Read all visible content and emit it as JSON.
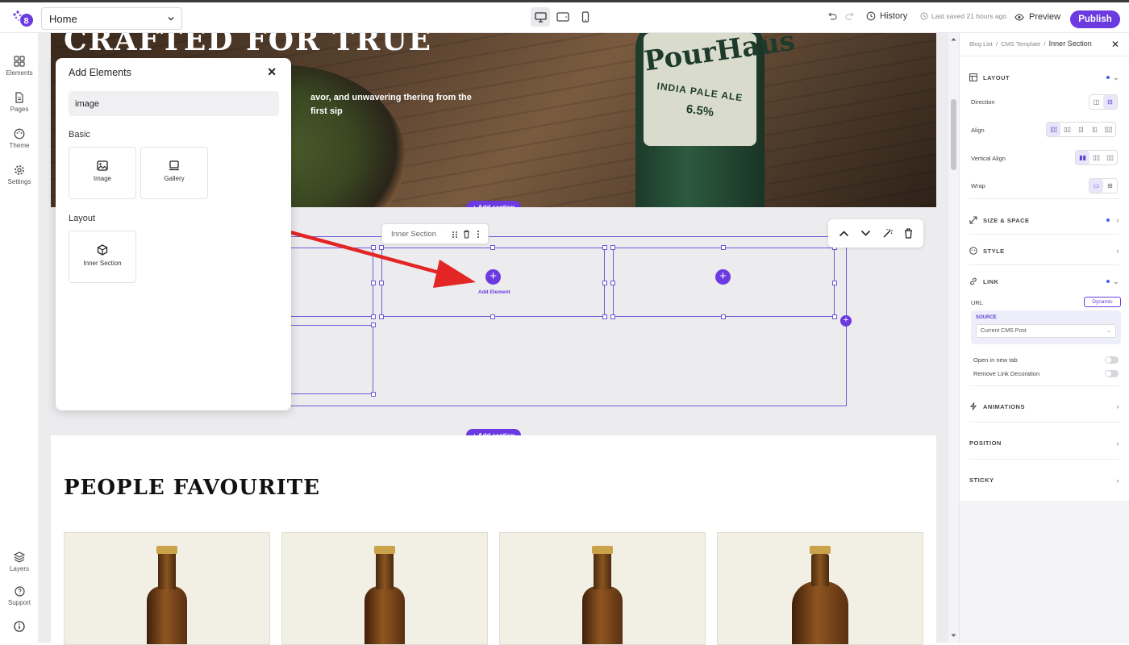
{
  "topbar": {
    "page_select": "Home",
    "history": "History",
    "last_saved": "Last saved 21 hours ago",
    "preview": "Preview",
    "publish": "Publish",
    "accent_color": "#6b3ae0"
  },
  "leftbar": {
    "items": [
      {
        "label": "Elements",
        "icon": "grid-icon"
      },
      {
        "label": "Pages",
        "icon": "page-icon"
      },
      {
        "label": "Theme",
        "icon": "palette-icon"
      },
      {
        "label": "Settings",
        "icon": "gear-icon"
      }
    ],
    "bottom": [
      {
        "label": "Layers",
        "icon": "layers-icon"
      },
      {
        "label": "Support",
        "icon": "help-icon"
      }
    ]
  },
  "canvas": {
    "hero_title": "CRAFTED FOR TRUE",
    "hero_text": "avor, and unwavering thering from the first sip",
    "bottle_brand": "PourHaus",
    "bottle_ipa": "INDIA PALE ALE",
    "bottle_abv": "6.5%",
    "add_section": "+ Add section",
    "add_element": "Add Element",
    "selected_tag": "Inner Section",
    "products_title": "PEOPLE FAVOURITE"
  },
  "modal": {
    "title": "Add Elements",
    "search_value": "image",
    "basic_label": "Basic",
    "layout_label": "Layout",
    "basic_tiles": [
      {
        "label": "Image",
        "icon": "image-icon"
      },
      {
        "label": "Gallery",
        "icon": "gallery-icon"
      }
    ],
    "layout_tiles": [
      {
        "label": "Inner Section",
        "icon": "cube-icon"
      }
    ]
  },
  "panel": {
    "breadcrumb": [
      "Blog List",
      "CMS Template",
      "Inner Section"
    ],
    "sections": {
      "layout": "LAYOUT",
      "size_space": "SIZE & SPACE",
      "style": "STYLE",
      "link": "LINK",
      "animations": "ANIMATIONS",
      "position": "POSITION",
      "sticky": "STICKY"
    },
    "props": {
      "direction": "Direction",
      "align": "Align",
      "vertical_align": "Vertical Align",
      "wrap": "Wrap",
      "url": "URL",
      "dynamic": "Dynamic",
      "source": "SOURCE",
      "source_value": "Current CMS Post",
      "open_new_tab": "Open in new tab",
      "remove_decoration": "Remove Link Decoration"
    }
  }
}
